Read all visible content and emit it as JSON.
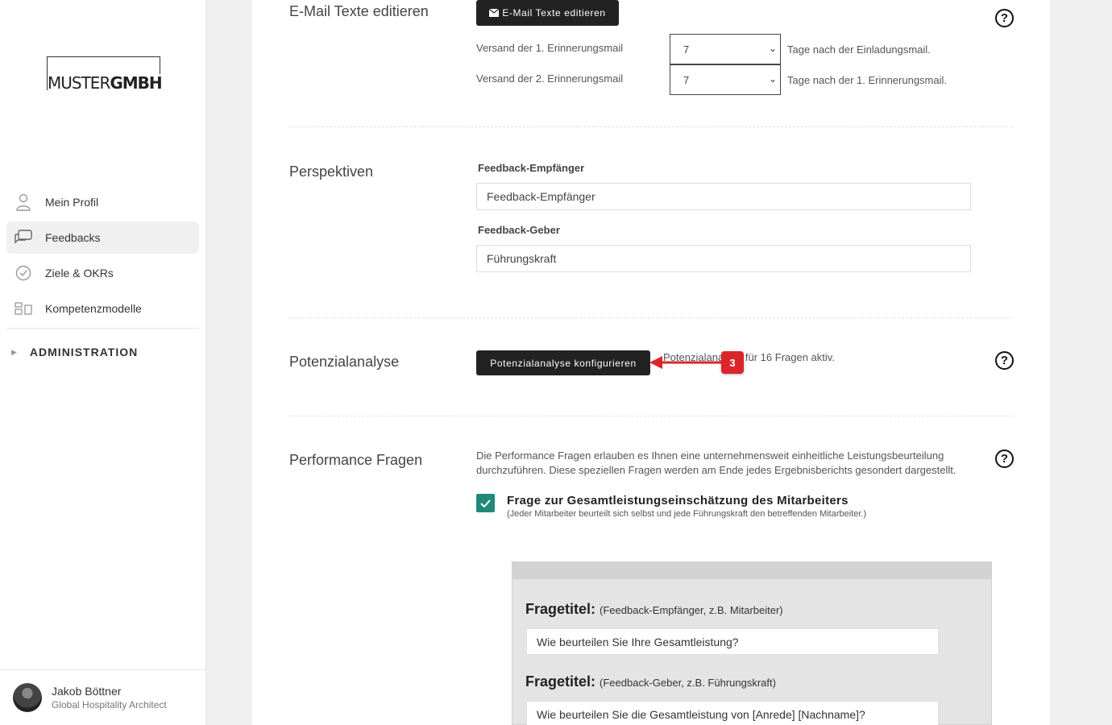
{
  "brand": {
    "logo_part1": "MUSTER",
    "logo_part2": "GMBH"
  },
  "sidebar": {
    "items": [
      {
        "label": "Mein Profil",
        "icon": "user-icon"
      },
      {
        "label": "Feedbacks",
        "icon": "chat-icon",
        "active": true
      },
      {
        "label": "Ziele & OKRs",
        "icon": "check-circle-icon"
      },
      {
        "label": "Kompetenzmodelle",
        "icon": "layout-icon"
      }
    ],
    "admin_label": "ADMINISTRATION"
  },
  "user": {
    "name": "Jakob Böttner",
    "role": "Global Hospitality Architect"
  },
  "email_section": {
    "label": "E-Mail Texte editieren",
    "button_label": "E-Mail Texte editieren",
    "reminder1_label": "Versand der 1. Erinnerungsmail",
    "reminder1_value": "7",
    "reminder1_after": "Tage nach der Einladungsmail.",
    "reminder2_label": "Versand der 2. Erinnerungsmail",
    "reminder2_value": "7",
    "reminder2_after": "Tage nach der 1. Erinnerungsmail."
  },
  "perspectives": {
    "label": "Perspektiven",
    "receiver_label": "Feedback-Empfänger",
    "receiver_value": "Feedback-Empfänger",
    "giver_label": "Feedback-Geber",
    "giver_value": "Führungskraft"
  },
  "potential": {
    "label": "Potenzialanalyse",
    "button_label": "Potenzialanalyse konfigurieren",
    "status_text": "Potenzialanalyse für 16 Fragen aktiv.",
    "badge": "3"
  },
  "performance": {
    "label": "Performance Fragen",
    "description": "Die Performance Fragen erlauben es Ihnen eine unternehmensweit einheitliche Leistungsbeurteilung durchzuführen. Diese speziellen Fragen werden am Ende jedes Ergebnisberichts gesondert dargestellt.",
    "checkbox_title": "Frage zur Gesamtleistungseinschätzung des Mitarbeiters",
    "checkbox_sub": "(Jeder Mitarbeiter beurteilt sich selbst und jede Führungskraft den betreffenden Mitarbeiter.)",
    "checked": true,
    "q1_title": "Fragetitel:",
    "q1_hint": "(Feedback-Empfänger, z.B. Mitarbeiter)",
    "q1_value": "Wie beurteilen Sie Ihre Gesamtleistung?",
    "q2_title": "Fragetitel:",
    "q2_hint": "(Feedback-Geber, z.B. Führungskraft)",
    "q2_value": "Wie beurteilen Sie die Gesamtleistung von [Anrede] [Nachname]?"
  },
  "colors": {
    "accent": "#1f8a78",
    "badge": "#d9262b",
    "dark_button": "#222222"
  }
}
